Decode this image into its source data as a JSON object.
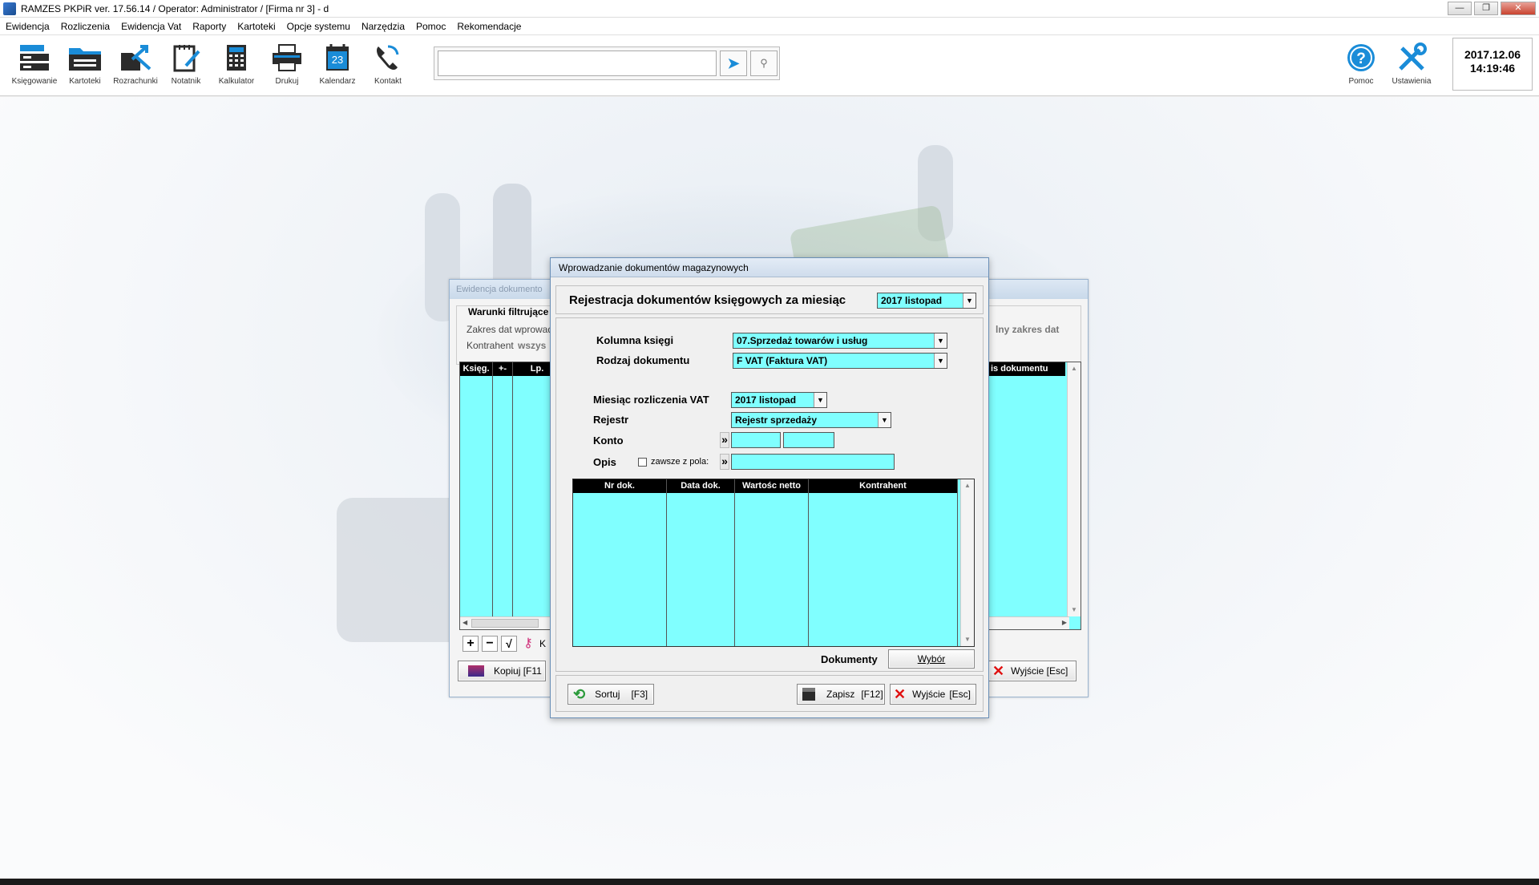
{
  "window": {
    "title": "RAMZES PKPiR ver. 17.56.14 /   Operator: Administrator /   [Firma nr 3] - d",
    "controls": [
      "—",
      "❐",
      "✕"
    ]
  },
  "menu": [
    "Ewidencja",
    "Rozliczenia",
    "Ewidencja Vat",
    "Raporty",
    "Kartoteki",
    "Opcje systemu",
    "Narzędzia",
    "Pomoc",
    "Rekomendacje"
  ],
  "toolbar": {
    "tools": [
      {
        "label": "Księgowanie",
        "icon": "bookkeeping-icon"
      },
      {
        "label": "Kartoteki",
        "icon": "folder-icon"
      },
      {
        "label": "Rozrachunki",
        "icon": "settlements-icon"
      },
      {
        "label": "Notatnik",
        "icon": "notepad-icon"
      },
      {
        "label": "Kalkulator",
        "icon": "calculator-icon"
      },
      {
        "label": "Drukuj",
        "icon": "printer-icon"
      },
      {
        "label": "Kalendarz",
        "icon": "calendar-icon"
      },
      {
        "label": "Kontakt",
        "icon": "phone-icon"
      }
    ],
    "calendar_day": "23",
    "search_value": "",
    "help_label": "Pomoc",
    "settings_label": "Ustawienia",
    "clock_date": "2017.12.06",
    "clock_time": "14:19:46"
  },
  "bg_window": {
    "title": "Ewidencja dokumento",
    "filter_title": "Warunki filtrujące",
    "zakres_label": "Zakres dat",
    "zakres_value": "wprowad",
    "kontrahent_label": "Kontrahent",
    "kontrahent_value": "wszys",
    "right_filter": "lny zakres dat",
    "columns": [
      "Księg.",
      "+-",
      "Lp."
    ],
    "right_column": "is dokumentu",
    "copy_button": "Kopiuj  [F11",
    "exit_button": "Wyjście  [Esc]",
    "key_label": "K"
  },
  "dialog": {
    "title": "Wprowadzanie dokumentów magazynowych",
    "header_label": "Rejestracja dokumentów księgowych za miesiąc",
    "month": "2017 listopad",
    "kolumna_label": "Kolumna księgi",
    "kolumna_value": "07.Sprzedaż towarów i usług",
    "rodzaj_label": "Rodzaj dokumentu",
    "rodzaj_value": "F VAT (Faktura VAT)",
    "miesiac_vat_label": "Miesiąc rozliczenia VAT",
    "miesiac_vat_value": "2017 listopad",
    "rejestr_label": "Rejestr",
    "rejestr_value": "Rejestr sprzedaży",
    "konto_label": "Konto",
    "opis_label": "Opis",
    "zawsze_label": "zawsze z pola:",
    "chevron": "»",
    "columns": [
      "Nr dok.",
      "Data dok.",
      "Wartośc netto",
      "Kontrahent"
    ],
    "dokumenty_label": "Dokumenty",
    "wybor_button": "Wybór",
    "sortuj_button": "Sortuj",
    "sortuj_key": "[F3]",
    "zapisz_button": "Zapisz",
    "zapisz_key": "[F12]",
    "wyjscie_button": "Wyjście",
    "wyjscie_key": "[Esc]"
  },
  "colors": {
    "grid": "#80ffff",
    "accent": "#1a8cd8"
  }
}
